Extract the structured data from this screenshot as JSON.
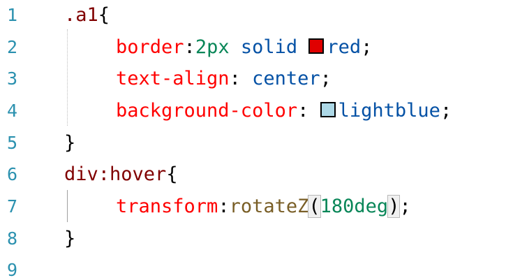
{
  "line_numbers": [
    "1",
    "2",
    "3",
    "4",
    "5",
    "6",
    "7",
    "8",
    "9"
  ],
  "code": {
    "l1": {
      "selector": ".a1",
      "brace": "{"
    },
    "l2": {
      "prop": "border",
      "colon": ":",
      "val1": "2px solid",
      "val2": "red",
      "semi": ";",
      "swatch_color": "#e00000",
      "swatch_icon": "color-swatch-icon"
    },
    "l3": {
      "prop": "text-align",
      "colon": ":",
      "val": " center",
      "semi": ";"
    },
    "l4": {
      "prop": "background-color",
      "colon": ":",
      "val": "lightblue",
      "semi": ";",
      "swatch_color": "#add8e6",
      "swatch_icon": "color-swatch-icon"
    },
    "l5": {
      "brace": "}"
    },
    "l6": {
      "selector": "div:hover",
      "brace": "{"
    },
    "l7": {
      "prop": "transform",
      "colon": ":",
      "func": "rotateZ",
      "open": "(",
      "num": "180deg",
      "close": ")",
      "semi": ";"
    },
    "l8": {
      "brace": "}"
    }
  },
  "colors": {
    "line_number": "#2b91af",
    "selector": "#800000",
    "property": "#ff0000",
    "value": "#0451a5",
    "number": "#098658",
    "function": "#795e26"
  }
}
